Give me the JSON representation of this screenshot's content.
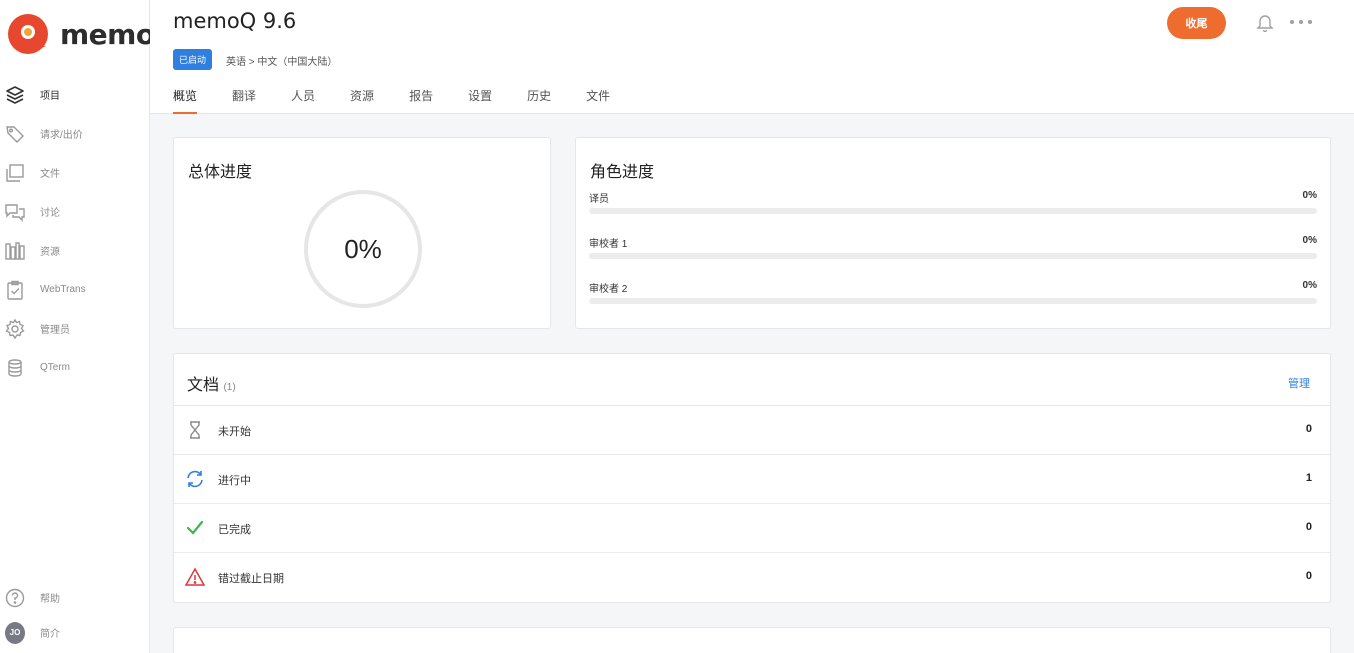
{
  "brand": {
    "name": "memoq",
    "accent": "#ef6c2f",
    "link": "#2e7fe0"
  },
  "sidebar": {
    "items": [
      {
        "label": "项目",
        "icon": "layers-icon",
        "active": true
      },
      {
        "label": "请求/出价",
        "icon": "tag-icon",
        "active": false
      },
      {
        "label": "文件",
        "icon": "folder-icon",
        "active": false
      },
      {
        "label": "讨论",
        "icon": "chat-icon",
        "active": false
      },
      {
        "label": "资源",
        "icon": "library-icon",
        "active": false
      },
      {
        "label": "WebTrans",
        "icon": "clipboard-check-icon",
        "active": false
      },
      {
        "label": "管理员",
        "icon": "gear-icon",
        "active": false
      },
      {
        "label": "QTerm",
        "icon": "database-icon",
        "active": false
      }
    ],
    "bottom": [
      {
        "label": "帮助",
        "icon": "help-icon"
      },
      {
        "label": "简介",
        "avatar": "JO"
      }
    ]
  },
  "header": {
    "title": "memoQ 9.6",
    "status": "已启动",
    "languages": "英语 > 中文（中国大陆）",
    "close_label": "收尾",
    "tabs": [
      "概览",
      "翻译",
      "人员",
      "资源",
      "报告",
      "设置",
      "历史",
      "文件"
    ],
    "active_tab": "概览"
  },
  "overall": {
    "title": "总体进度",
    "value": "0%",
    "progress": 0
  },
  "roles": {
    "title": "角色进度",
    "items": [
      {
        "name": "译员",
        "value": "0%"
      },
      {
        "name": "审校者 1",
        "value": "0%"
      },
      {
        "name": "审校者 2",
        "value": "0%"
      }
    ]
  },
  "documents": {
    "title": "文档",
    "count": "(1)",
    "manage_label": "管理",
    "rows": [
      {
        "label": "未开始",
        "value": "0",
        "icon": "hourglass-icon"
      },
      {
        "label": "进行中",
        "value": "1",
        "icon": "refresh-icon"
      },
      {
        "label": "已完成",
        "value": "0",
        "icon": "check-icon"
      },
      {
        "label": "错过截止日期",
        "value": "0",
        "icon": "warning-icon"
      }
    ]
  }
}
